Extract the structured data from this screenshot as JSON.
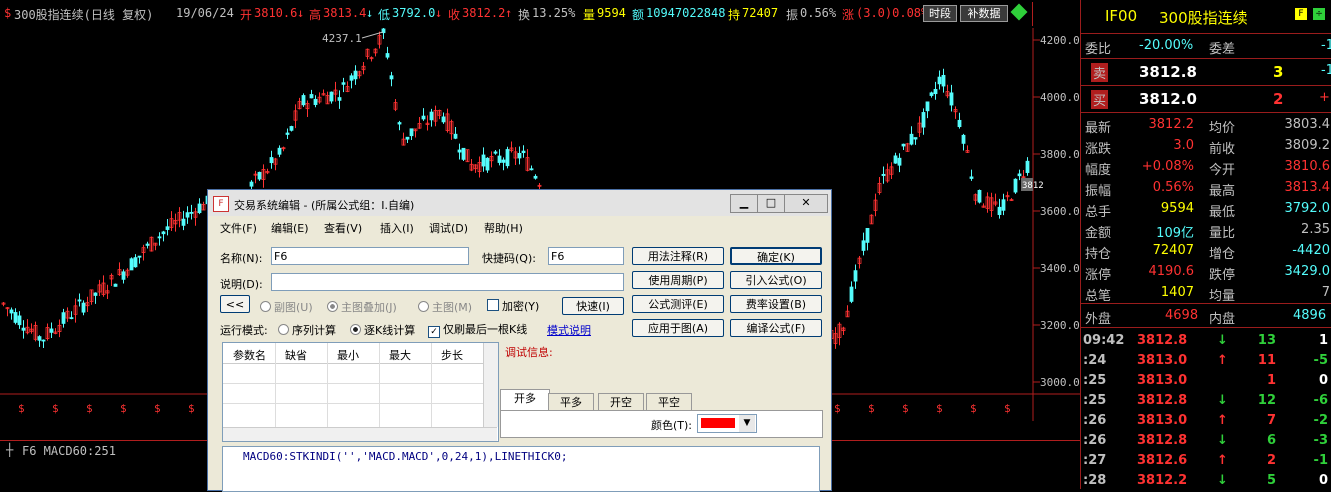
{
  "topbar": {
    "title": "300股指连续(日线 复权)",
    "date": "19/06/24",
    "open_label": "开",
    "open": "3810.6",
    "high_label": "高",
    "high": "3813.4",
    "low_label": "低",
    "low": "3792.0",
    "close_label": "收",
    "close": "3812.2",
    "turnover_label": "换",
    "turnover": "13.25%",
    "volume_label": "量",
    "volume": "9594",
    "amount_label": "额",
    "amount": "10947022848",
    "hold_label": "持",
    "hold": "72407",
    "amplitude_label": "振",
    "amplitude": "0.56%",
    "change_label": "涨",
    "change": "(3.0)0.08%",
    "period_button": "时段",
    "fill_data_button": "补数据"
  },
  "chart": {
    "peak_label": "4237.1",
    "y_ticks": [
      "4200.0",
      "4000.0",
      "3800.0",
      "3600.0",
      "3400.0",
      "3200.0",
      "3000.0"
    ],
    "x_labels_left": [
      "2017",
      "06",
      "07",
      "08"
    ],
    "x_labels_right": [
      "02",
      "03",
      "04",
      "05",
      "06"
    ],
    "period_tab": "日线",
    "price_marker": "3812",
    "indicator_label": "F6 MACD60:251",
    "colors": {
      "up": "#ff3232",
      "down": "#54fcfc",
      "axis": "#b01e1e",
      "text": "#c0c0c0"
    }
  },
  "right_panel": {
    "code": "IF00",
    "name": "300股指连续",
    "ratio_label": "委比",
    "ratio": "-20.00%",
    "diff_label": "委差",
    "diff": "-1",
    "sell_label": "卖",
    "sell_price": "3812.8",
    "sell_vol": "3",
    "sell_chg": "-1",
    "buy_label": "买",
    "buy_price": "3812.0",
    "buy_vol": "2",
    "buy_chg": "+1",
    "stats": [
      {
        "k1": "最新",
        "v1": "3812.2",
        "k2": "均价",
        "v2": "3803.4"
      },
      {
        "k1": "涨跌",
        "v1": "3.0",
        "k2": "前收",
        "v2": "3809.2"
      },
      {
        "k1": "幅度",
        "v1": "+0.08%",
        "k2": "今开",
        "v2": "3810.6"
      },
      {
        "k1": "振幅",
        "v1": "0.56%",
        "k2": "最高",
        "v2": "3813.4"
      },
      {
        "k1": "总手",
        "v1": "9594",
        "k2": "最低",
        "v2": "3792.0"
      },
      {
        "k1": "金额",
        "v1": "109亿",
        "k2": "量比",
        "v2": "2.35"
      },
      {
        "k1": "持仓",
        "v1": "72407",
        "k2": "增仓",
        "v2": "-4420"
      },
      {
        "k1": "涨停",
        "v1": "4190.6",
        "k2": "跌停",
        "v2": "3429.0"
      },
      {
        "k1": "总笔",
        "v1": "1407",
        "k2": "均量",
        "v2": "7"
      }
    ],
    "outer_label": "外盘",
    "outer": "4698",
    "inner_label": "内盘",
    "inner": "4896",
    "ticks": [
      {
        "time": "09:42",
        "price": "3812.8",
        "dir": "↓",
        "vol": "13",
        "chg": "1"
      },
      {
        "time": ":24",
        "price": "3813.0",
        "dir": "↑",
        "vol": "11",
        "chg": "-5"
      },
      {
        "time": ":25",
        "price": "3813.0",
        "dir": "",
        "vol": "1",
        "chg": "0"
      },
      {
        "time": ":25",
        "price": "3812.8",
        "dir": "↓",
        "vol": "12",
        "chg": "-6"
      },
      {
        "time": ":26",
        "price": "3813.0",
        "dir": "↑",
        "vol": "7",
        "chg": "-2"
      },
      {
        "time": ":26",
        "price": "3812.8",
        "dir": "↓",
        "vol": "6",
        "chg": "-3"
      },
      {
        "time": ":27",
        "price": "3812.6",
        "dir": "↑",
        "vol": "2",
        "chg": "-1"
      },
      {
        "time": ":28",
        "price": "3812.2",
        "dir": "↓",
        "vol": "5",
        "chg": "0"
      }
    ]
  },
  "dialog": {
    "title": "交易系统编辑 - (所属公式组：I.自编)",
    "menu": [
      "文件(F)",
      "编辑(E)",
      "查看(V)",
      "插入(I)",
      "调试(D)",
      "帮助(H)"
    ],
    "name_label": "名称(N):",
    "name_value": "F6",
    "shortcut_label": "快捷码(Q):",
    "shortcut_value": "F6",
    "desc_label": "说明(D):",
    "collapse_button": "<<",
    "radio_sub": "副图(U)",
    "radio_overlay": "主图叠加(J)",
    "radio_main": "主图(M)",
    "encrypt_label": "加密(Y)",
    "quick_button": "快速(I)",
    "run_mode_label": "运行模式:",
    "run_seq": "序列计算",
    "run_kline": "逐K线计算",
    "refresh_last": "仅刷最后一根K线",
    "mode_help": "模式说明",
    "btn_usage": "用法注释(R)",
    "btn_ok": "确定(K)",
    "btn_period": "使用周期(P)",
    "btn_import": "引入公式(O)",
    "btn_test": "公式测评(E)",
    "btn_fee": "费率设置(B)",
    "btn_apply": "应用于图(A)",
    "btn_compile": "编译公式(F)",
    "param_headers": [
      "参数名",
      "缺省",
      "最小",
      "最大",
      "步长"
    ],
    "debug_label": "调试信息:",
    "tabs": [
      "开多",
      "平多",
      "开空",
      "平空"
    ],
    "color_label": "颜色(T):",
    "code": "MACD60:STKINDI('','MACD.MACD',0,24,1),LINETHICK0;"
  }
}
